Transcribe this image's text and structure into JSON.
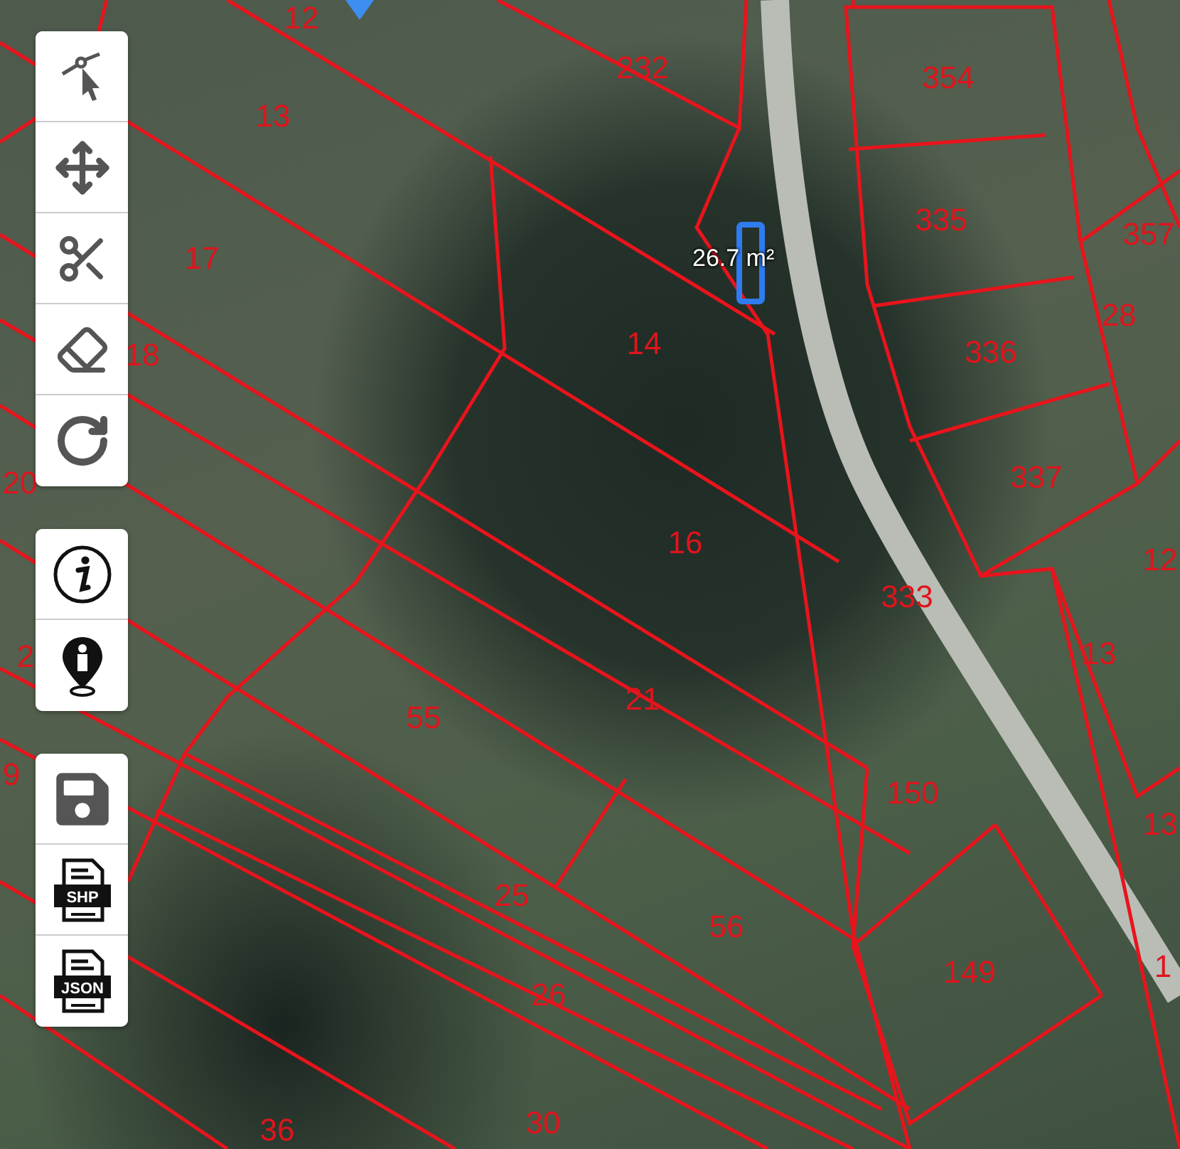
{
  "toolbar": {
    "groups": [
      {
        "tools": [
          {
            "kind": "draw"
          },
          {
            "kind": "move"
          },
          {
            "kind": "cut"
          },
          {
            "kind": "erase"
          },
          {
            "kind": "undo"
          }
        ]
      },
      {
        "tools": [
          {
            "kind": "info"
          },
          {
            "kind": "locate"
          }
        ]
      },
      {
        "tools": [
          {
            "kind": "save"
          },
          {
            "kind": "export",
            "label": "SHP"
          },
          {
            "kind": "export",
            "label": "JSON"
          }
        ]
      }
    ]
  },
  "measurement": {
    "text": "26.7 m²"
  },
  "parcels": [
    {
      "label": "12"
    },
    {
      "label": "232"
    },
    {
      "label": "354"
    },
    {
      "label": "13"
    },
    {
      "label": "335"
    },
    {
      "label": "357"
    },
    {
      "label": "17"
    },
    {
      "label": "28"
    },
    {
      "label": "18"
    },
    {
      "label": "14"
    },
    {
      "label": "336"
    },
    {
      "label": "20"
    },
    {
      "label": "337"
    },
    {
      "label": "16"
    },
    {
      "label": "12"
    },
    {
      "label": "333"
    },
    {
      "label": "2"
    },
    {
      "label": "13"
    },
    {
      "label": "55"
    },
    {
      "label": "21"
    },
    {
      "label": "9"
    },
    {
      "label": "150"
    },
    {
      "label": "13"
    },
    {
      "label": "25"
    },
    {
      "label": "56"
    },
    {
      "label": "149"
    },
    {
      "label": "1"
    },
    {
      "label": "26"
    },
    {
      "label": "36"
    },
    {
      "label": "30"
    }
  ]
}
